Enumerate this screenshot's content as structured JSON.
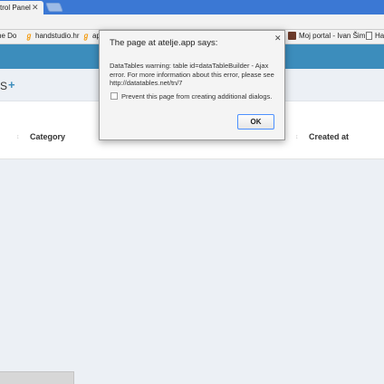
{
  "browser": {
    "tab_title": "trol Panel",
    "tab_close": "✕"
  },
  "bookmarks": [
    {
      "label": "ne Do",
      "icon": "none"
    },
    {
      "label": "handstudio.hr",
      "icon": "handstudio-icon"
    },
    {
      "label": "ap",
      "icon": "handstudio-icon"
    },
    {
      "label": "Moj portal - Ivan Šim",
      "icon": "portal-icon"
    },
    {
      "label": "Ha",
      "icon": "document-icon"
    }
  ],
  "page": {
    "title": "S",
    "add_symbol": "+",
    "table_headers": [
      "Category",
      "Created at"
    ],
    "sort_symbol": "↕"
  },
  "dialog": {
    "title": "The page at atelje.app says:",
    "close_symbol": "✕",
    "message": "DataTables warning: table id=dataTableBuilder - Ajax error. For more information about this error, please see http://datatables.net/tn/7",
    "checkbox_label": "Prevent this page from creating additional dialogs.",
    "checkbox_checked": false,
    "ok_label": "OK"
  },
  "colors": {
    "tabstrip": "#3b78d4",
    "appbar": "#3c8dbc",
    "accent": "#3c8dbc"
  }
}
